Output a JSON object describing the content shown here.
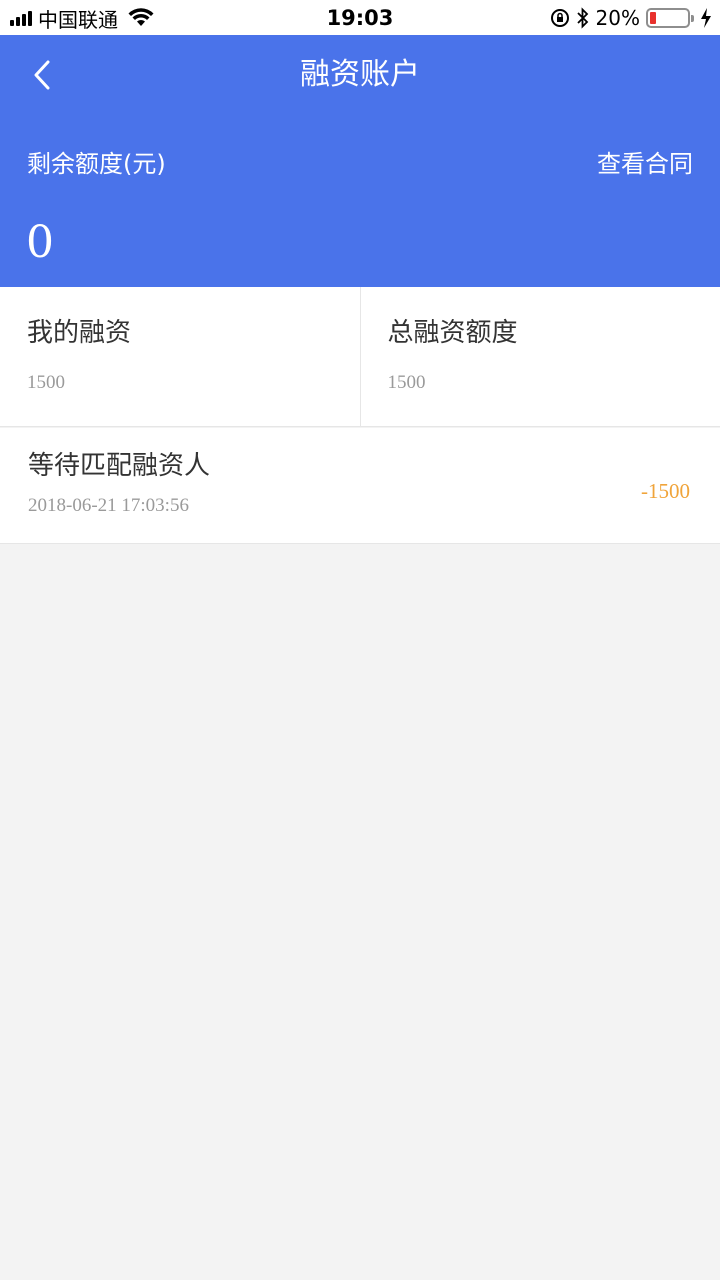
{
  "status_bar": {
    "carrier": "中国联通",
    "time": "19:03",
    "battery_percent": "20%",
    "battery_level": 0.2,
    "icons": [
      "signal-icon",
      "wifi-icon",
      "orientation-lock-icon",
      "bluetooth-icon",
      "battery-icon",
      "charging-icon"
    ]
  },
  "header": {
    "title": "融资账户",
    "remaining_label": "剩余额度(元)",
    "view_contract": "查看合同",
    "remaining_value": "0",
    "background_color": "#4a73ea"
  },
  "stats": [
    {
      "label": "我的融资",
      "value": "1500"
    },
    {
      "label": "总融资额度",
      "value": "1500"
    }
  ],
  "records": [
    {
      "title": "等待匹配融资人",
      "time": "2018-06-21 17:03:56",
      "amount": "-1500",
      "amount_color": "#f0a43a"
    }
  ]
}
